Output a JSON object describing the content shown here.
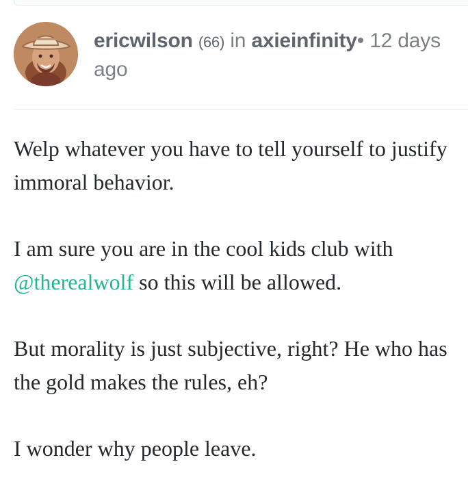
{
  "comment": {
    "author": "ericwilson",
    "reputation": "(66)",
    "in_label": "in",
    "community": "axieinfinity",
    "separator": "•",
    "timestamp": "12 days ago",
    "avatar_icon": "profile-photo-cowboy-hat",
    "paragraphs": [
      "Welp whatever you have to tell yourself to justify immoral behavior.",
      {
        "mention": "@therealwolf",
        "text_after_prefix": "I am sure you are in the cool kids club with",
        "text_after": "so this will be allowed."
      },
      "But morality is just subjective, right? He who has the gold makes the rules, eh?",
      "I wonder why people leave."
    ]
  },
  "colors": {
    "text": "#23282d",
    "meta": "#7b8087",
    "author": "#5f656d",
    "mention": "#1fb890",
    "divider": "#e6e9ec"
  }
}
